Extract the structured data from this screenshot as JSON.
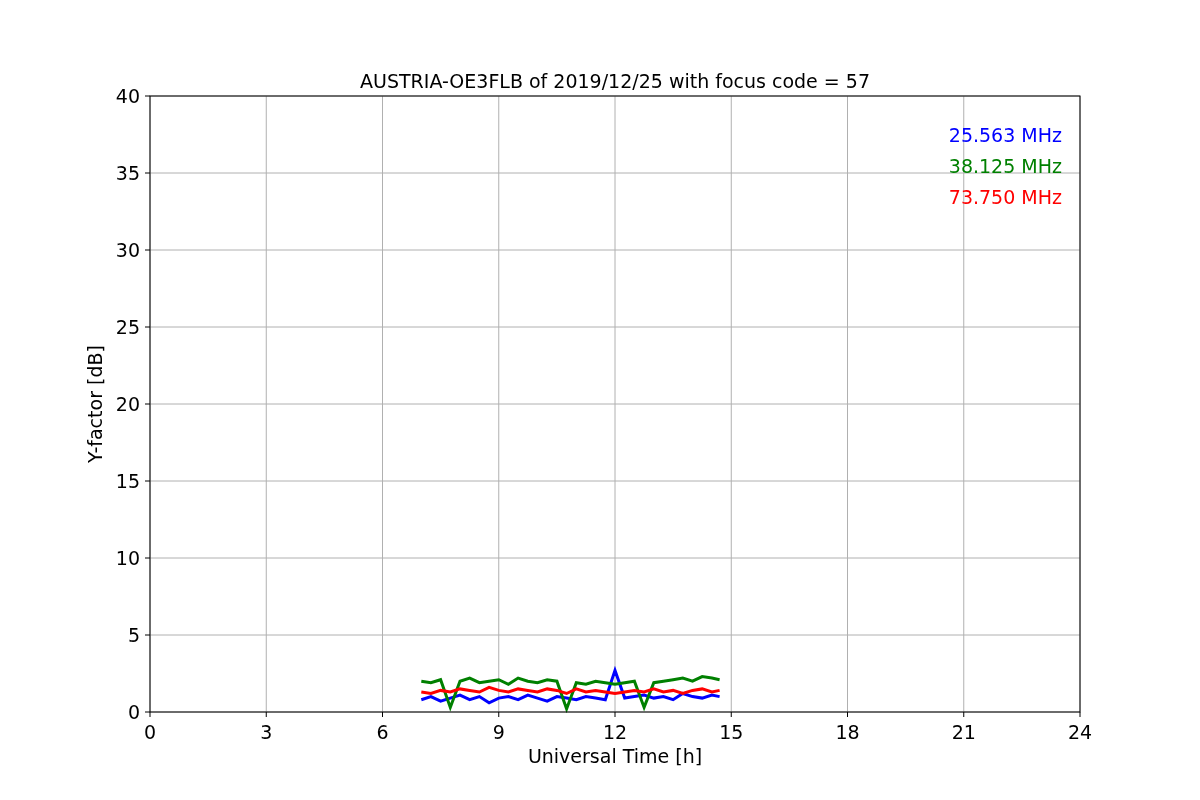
{
  "figure": {
    "chart_data": {
      "type": "line",
      "title": "AUSTRIA-OE3FLB of 2019/12/25 with focus code = 57",
      "xlabel": "Universal Time [h]",
      "ylabel": "Y-factor [dB]",
      "x": [
        7,
        7.25,
        7.5,
        7.75,
        8,
        8.25,
        8.5,
        8.75,
        9,
        9.25,
        9.5,
        9.75,
        10,
        10.25,
        10.5,
        10.75,
        11,
        11.25,
        11.5,
        11.75,
        12,
        12.25,
        12.5,
        12.75,
        13,
        13.25,
        13.5,
        13.75,
        14,
        14.25,
        14.5,
        14.7
      ],
      "series": [
        {
          "name": "25.563 MHz",
          "color": "#0000ff",
          "values": [
            0.8,
            1.0,
            0.7,
            0.9,
            1.1,
            0.8,
            1.0,
            0.6,
            0.9,
            1.0,
            0.8,
            1.1,
            0.9,
            0.7,
            1.0,
            0.9,
            0.8,
            1.0,
            0.9,
            0.8,
            2.7,
            0.9,
            1.0,
            1.1,
            0.9,
            1.0,
            0.8,
            1.2,
            1.0,
            0.9,
            1.1,
            1.0
          ]
        },
        {
          "name": "38.125 MHz",
          "color": "#008000",
          "values": [
            2.0,
            1.9,
            2.1,
            0.3,
            2.0,
            2.2,
            1.9,
            2.0,
            2.1,
            1.8,
            2.2,
            2.0,
            1.9,
            2.1,
            2.0,
            0.2,
            1.9,
            1.8,
            2.0,
            1.9,
            1.8,
            1.9,
            2.0,
            0.3,
            1.9,
            2.0,
            2.1,
            2.2,
            2.0,
            2.3,
            2.2,
            2.1
          ]
        },
        {
          "name": "73.750 MHz",
          "color": "#ff0000",
          "values": [
            1.3,
            1.2,
            1.4,
            1.3,
            1.5,
            1.4,
            1.3,
            1.6,
            1.4,
            1.3,
            1.5,
            1.4,
            1.3,
            1.5,
            1.4,
            1.2,
            1.5,
            1.3,
            1.4,
            1.3,
            1.2,
            1.3,
            1.4,
            1.3,
            1.5,
            1.3,
            1.4,
            1.2,
            1.4,
            1.5,
            1.3,
            1.4
          ]
        }
      ],
      "xlim": [
        0,
        24
      ],
      "ylim": [
        0,
        40
      ],
      "xticks": [
        0,
        3,
        6,
        9,
        12,
        15,
        18,
        21,
        24
      ],
      "yticks": [
        0,
        5,
        10,
        15,
        20,
        25,
        30,
        35,
        40
      ],
      "grid": true
    }
  }
}
